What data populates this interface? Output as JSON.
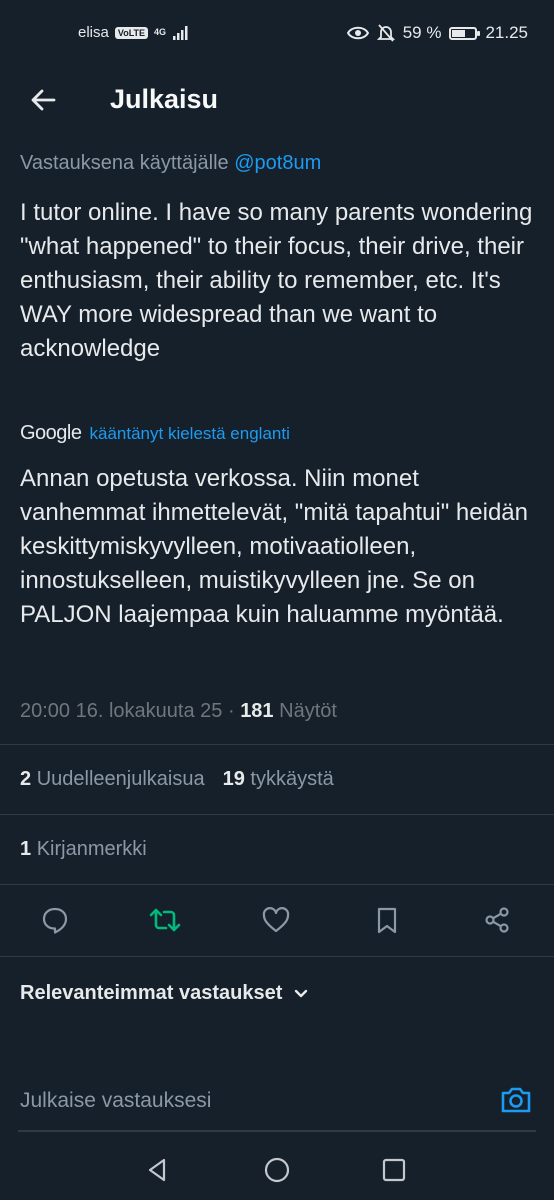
{
  "status_bar": {
    "carrier": "elisa",
    "volte": "VoLTE",
    "network": "4G",
    "battery": "59 %",
    "battery_level": 0.59,
    "time": "21.25"
  },
  "header": {
    "title": "Julkaisu"
  },
  "post": {
    "reply_prefix": "Vastauksena käyttäjälle",
    "reply_mention": "@pot8um",
    "original_text": "I tutor online. I have so many parents wondering \"what happened\" to their focus, their drive, their enthusiasm, their ability to remember, etc. It's WAY more widespread than we want to acknowledge",
    "translator_brand": "Google",
    "translated_note": "kääntänyt kielestä englanti",
    "translated_text": "Annan opetusta verkossa. Niin monet vanhemmat ihmettelevät, \"mitä tapahtui\" heidän keskittymiskyvylleen, motivaatiolleen, innostukselleen, muistikyvylleen jne. Se on PALJON laajempaa kuin haluamme myöntää.",
    "timestamp": "20:00 16. lokakuuta 25",
    "separator": "·",
    "views_count": "181",
    "views_label": "Näytöt"
  },
  "stats": {
    "reposts_count": "2",
    "reposts_label": "Uudelleenjulkaisua",
    "likes_count": "19",
    "likes_label": "tykkäystä",
    "bookmarks_count": "1",
    "bookmarks_label": "Kirjanmerkki"
  },
  "actions": [
    {
      "icon": "reply-icon"
    },
    {
      "icon": "repost-icon",
      "color": "#00ba7c"
    },
    {
      "icon": "like-icon"
    },
    {
      "icon": "bookmark-icon"
    },
    {
      "icon": "share-icon"
    }
  ],
  "replies": {
    "sort_label": "Relevanteimmat vastaukset"
  },
  "composer": {
    "placeholder": "Julkaise vastauksesi"
  },
  "colors": {
    "background": "#15202b",
    "accent": "#1d9bf0",
    "repost_active": "#00ba7c",
    "secondary_text": "#8b98a5"
  }
}
